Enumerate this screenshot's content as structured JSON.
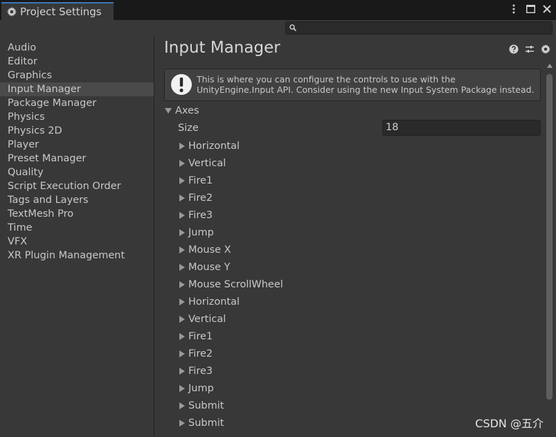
{
  "window": {
    "tab_title": "Project Settings",
    "icons": [
      "gear-icon",
      "more-vertical-icon",
      "maximize-icon",
      "close-icon"
    ]
  },
  "search": {
    "value": "",
    "placeholder": ""
  },
  "sidebar": {
    "items": [
      {
        "label": "Audio",
        "selected": false
      },
      {
        "label": "Editor",
        "selected": false
      },
      {
        "label": "Graphics",
        "selected": false
      },
      {
        "label": "Input Manager",
        "selected": true
      },
      {
        "label": "Package Manager",
        "selected": false
      },
      {
        "label": "Physics",
        "selected": false
      },
      {
        "label": "Physics 2D",
        "selected": false
      },
      {
        "label": "Player",
        "selected": false
      },
      {
        "label": "Preset Manager",
        "selected": false
      },
      {
        "label": "Quality",
        "selected": false
      },
      {
        "label": "Script Execution Order",
        "selected": false
      },
      {
        "label": "Tags and Layers",
        "selected": false
      },
      {
        "label": "TextMesh Pro",
        "selected": false
      },
      {
        "label": "Time",
        "selected": false
      },
      {
        "label": "VFX",
        "selected": false
      },
      {
        "label": "XR Plugin Management",
        "selected": false
      }
    ]
  },
  "main": {
    "title": "Input Manager",
    "header_icons": [
      "help-icon",
      "preset-icon",
      "settings-gear-icon"
    ],
    "help_box": {
      "line1": "This is where you can configure the controls to use with the",
      "line2": "UnityEngine.Input API. Consider using the new Input System Package instead."
    },
    "axes_label": "Axes",
    "size_label": "Size",
    "size_value": "18",
    "axes": [
      "Horizontal",
      "Vertical",
      "Fire1",
      "Fire2",
      "Fire3",
      "Jump",
      "Mouse X",
      "Mouse Y",
      "Mouse ScrollWheel",
      "Horizontal",
      "Vertical",
      "Fire1",
      "Fire2",
      "Fire3",
      "Jump",
      "Submit",
      "Submit"
    ]
  },
  "watermark": "CSDN @五介",
  "colors": {
    "accent": "#3a79bb",
    "selected_bg": "#4a4a4a",
    "panel_bg": "#383838"
  }
}
